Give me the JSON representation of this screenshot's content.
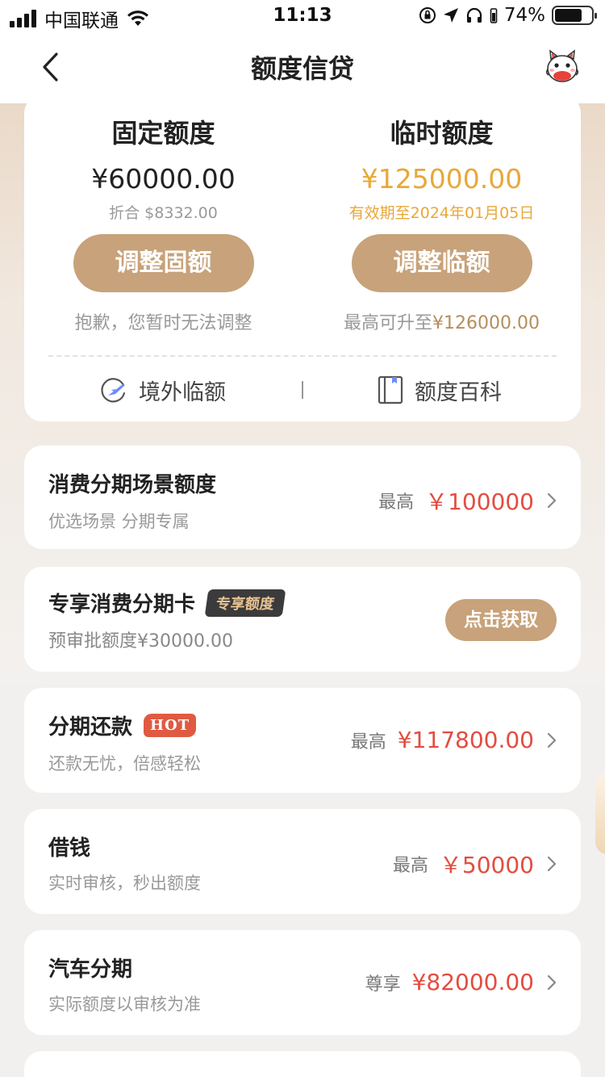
{
  "status_bar": {
    "carrier": "中国联通",
    "time": "11:13",
    "battery_pct": "74%",
    "battery_level": 0.74
  },
  "nav": {
    "title": "额度信贷"
  },
  "quota": {
    "fixed": {
      "title": "固定额度",
      "amount": "¥60000.00",
      "sub": "折合 $8332.00",
      "button": "调整固额",
      "note": "抱歉，您暂时无法调整"
    },
    "temp": {
      "title": "临时额度",
      "amount": "¥125000.00",
      "sub": "有效期至2024年01月05日",
      "button": "调整临额",
      "note_prefix": "最高可升至",
      "note_value": "¥126000.00"
    },
    "links": {
      "overseas": "境外临额",
      "wiki": "额度百科"
    }
  },
  "items": [
    {
      "title": "消费分期场景额度",
      "sub": "优选场景 分期专属",
      "prefix": "最高",
      "amount": "￥100000"
    },
    {
      "title": "专享消费分期卡",
      "badge": "专享额度",
      "sub": "预审批额度¥30000.00",
      "button": "点击获取"
    },
    {
      "title": "分期还款",
      "badge": "HOT",
      "sub": "还款无忧，倍感轻松",
      "prefix": "最高",
      "amount": "¥117800.00"
    },
    {
      "title": "借钱",
      "sub": "实时审核，秒出额度",
      "prefix": "最高",
      "amount": "￥50000"
    },
    {
      "title": "汽车分期",
      "sub": "实际额度以审核为准",
      "prefix": "尊享",
      "amount": "¥82000.00"
    }
  ],
  "colors": {
    "accent_gold": "#c7a27a",
    "amount_red": "#e34d40",
    "temp_gold": "#e8a83a"
  }
}
